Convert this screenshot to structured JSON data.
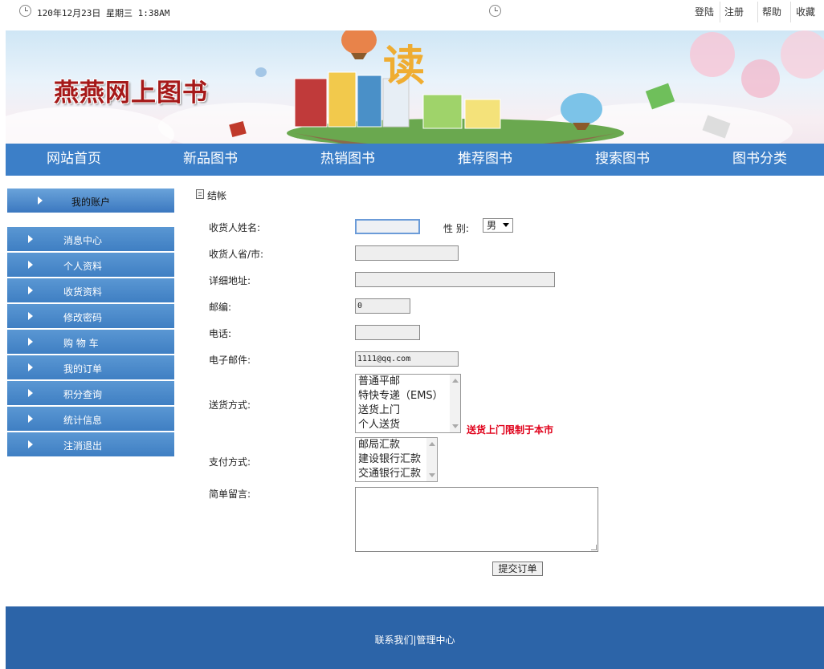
{
  "topbar": {
    "datetime": "120年12月23日 星期三 1:38AM",
    "links": [
      "登陆",
      "注册",
      "帮助",
      "收藏"
    ]
  },
  "banner": {
    "site_title": "燕燕网上图书"
  },
  "nav": {
    "items": [
      "网站首页",
      "新品图书",
      "热销图书",
      "推荐图书",
      "搜索图书",
      "图书分类"
    ]
  },
  "sidebar": {
    "header": "我的账户",
    "items": [
      "消息中心",
      "个人资料",
      "收货资料",
      "修改密码",
      "购 物 车",
      "我的订单",
      "积分查询",
      "统计信息",
      "注消退出"
    ]
  },
  "checkout": {
    "title": "结帐",
    "labels": {
      "name": "收货人姓名:",
      "gender": "性 别:",
      "province": "收货人省/市:",
      "address": "详细地址:",
      "zip": "邮编:",
      "phone": "电话:",
      "email": "电子邮件:",
      "delivery": "送货方式:",
      "payment": "支付方式:",
      "message": "简单留言:"
    },
    "values": {
      "gender": "男",
      "zip": "0",
      "email": "1111@qq.com"
    },
    "delivery_options": [
      "普通平邮",
      "特快专递（EMS）",
      "送货上门",
      "个人送货"
    ],
    "delivery_note": "送货上门限制于本市",
    "payment_options": [
      "邮局汇款",
      "建设银行汇款",
      "交通银行汇款"
    ],
    "submit_label": "提交订单",
    "note_color": "#e0001a"
  },
  "footer": {
    "links": "联系我们|管理中心"
  }
}
